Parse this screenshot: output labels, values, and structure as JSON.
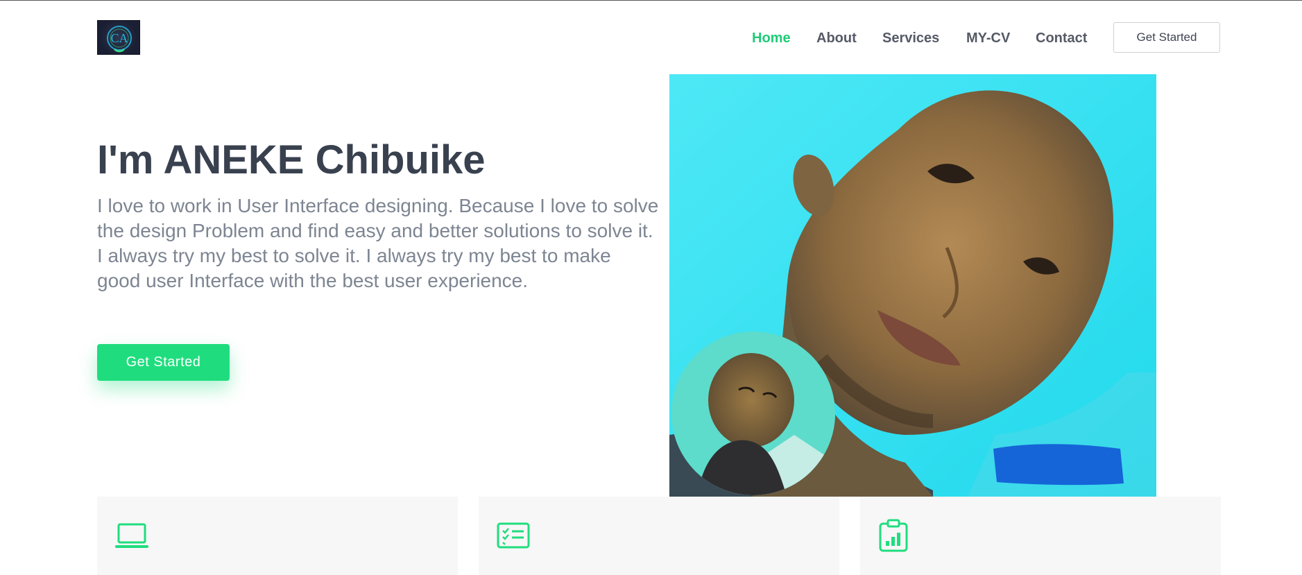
{
  "header": {
    "logo": {
      "text": "CA"
    },
    "nav": [
      {
        "label": "Home",
        "active": true
      },
      {
        "label": "About",
        "active": false
      },
      {
        "label": "Services",
        "active": false
      },
      {
        "label": "MY-CV",
        "active": false
      },
      {
        "label": "Contact",
        "active": false
      }
    ],
    "cta_label": "Get Started"
  },
  "hero": {
    "title": "I'm ANEKE Chibuike",
    "description": "I love to work in User Interface designing. Because I love to solve the design Problem and find easy and better solutions to solve it. I always try my best to solve it. I always try my best to make good user Interface with the best user experience.",
    "cta_label": "Get Started"
  },
  "cards": [
    {
      "icon": "laptop-icon"
    },
    {
      "icon": "checklist-icon"
    },
    {
      "icon": "clipboard-chart-icon"
    }
  ],
  "colors": {
    "accent": "#1fdd7e",
    "active_nav": "#1fcb77",
    "heading": "#39414f",
    "body_text": "#7d8592",
    "photo_bg": "#3fe6f2"
  }
}
